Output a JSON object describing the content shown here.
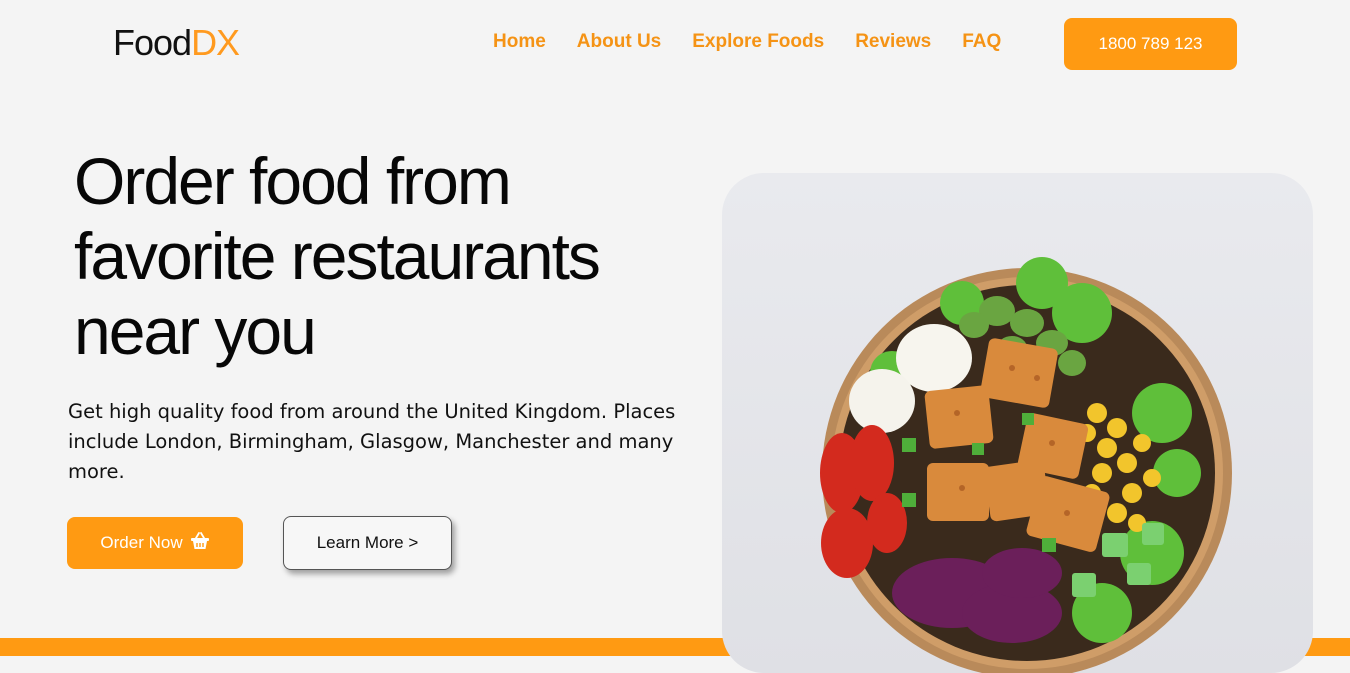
{
  "header": {
    "logo_primary": "Food",
    "logo_accent": "DX",
    "nav": [
      {
        "label": "Home"
      },
      {
        "label": "About Us"
      },
      {
        "label": "Explore Foods"
      },
      {
        "label": "Reviews"
      },
      {
        "label": "FAQ"
      }
    ],
    "phone_label": "1800 789 123"
  },
  "hero": {
    "title_line1": "Order food from",
    "title_line2": "favorite restaurants",
    "title_line3": "near you",
    "subtitle": "Get high quality food from around the United Kingdom. Places include London, Birmingham, Glasgow, Manchester and many more.",
    "order_button_label": "Order Now",
    "order_button_icon": "basket-icon",
    "learn_button_label": "Learn More >"
  },
  "image": {
    "description_icon": "salad-bowl-image"
  },
  "colors": {
    "accent": "#ff9a12",
    "nav_text": "#f59315",
    "background": "#f4f4f4",
    "title": "#070707"
  }
}
